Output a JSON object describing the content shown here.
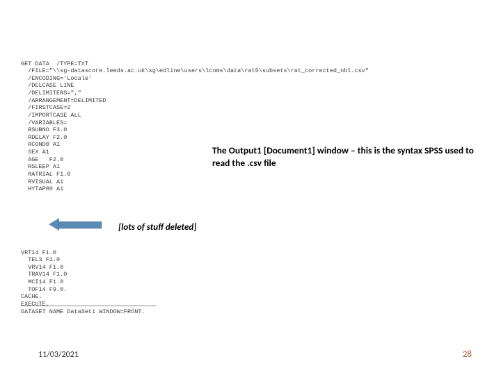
{
  "caption": "The Output1 [Document1] window – this is the syntax SPSS used to read the .csv file",
  "deleted_note": "[lots of stuff deleted]",
  "footer": {
    "date": "11/03/2021",
    "page": "28"
  },
  "code_top": "GET DATA  /TYPE=TXT\n  /FILE=\"\\\\sg-datascore.leeds.ac.uk\\sg\\edline\\users\\lcoms\\data\\rat5\\subsets\\rat_corrected_nbl.csv\"\n  /ENCODING='Locale'\n  /DELCASE LINE\n  /DELIMITERS=\",\"\n  /ARRANGEMENT=DELIMITED\n  /FIRSTCASE=2\n  /IMPORTCASE ALL\n  /VARIABLES=\n  RSUBNO F3.0\n  RDELAY F2.0\n  RCOND0 A1\n  SEX A1\n  AGE   F2.0\n  RSLEEP A1\n  RATRIAL F1.0\n  RVISUAL A1\n  HYTAP00 A1",
  "code_bottom": "VRT14 F1.0\n  TEL3 F1.0\n  VRV14 F1.0\n  TRAV14 F1.0\n  MCI14 F1.0\n  TOF14 F9.0.\nCACHE.\nEXECUTE.\nDATASET NAME DataSet1 WINDOW=FRONT.",
  "arrow_name": "arrow-left"
}
